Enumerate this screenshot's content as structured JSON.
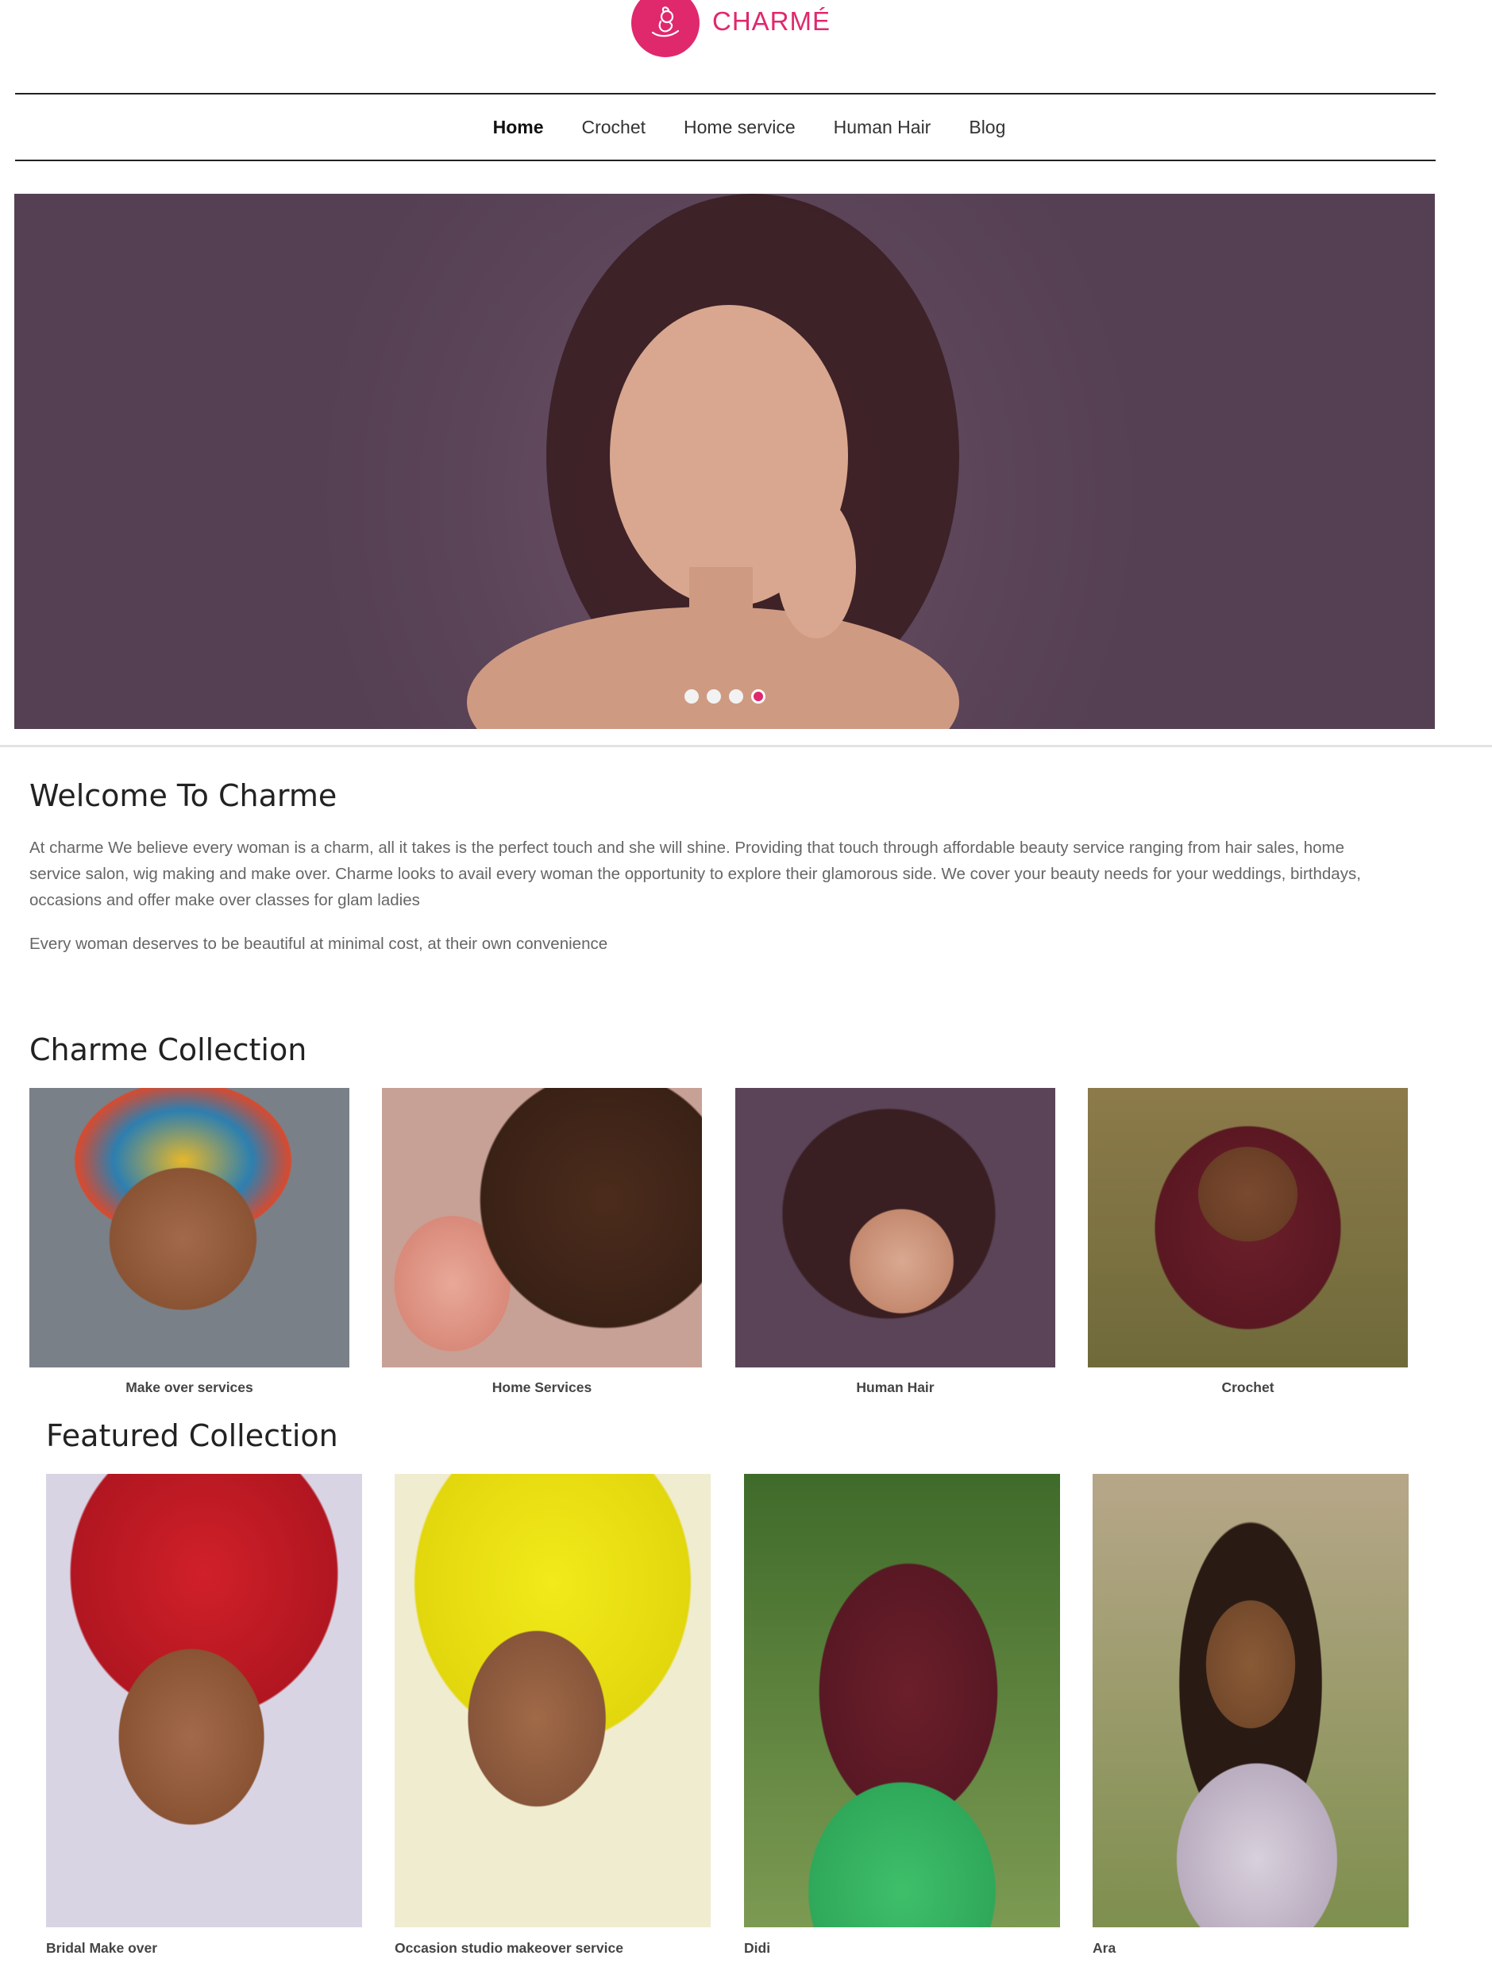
{
  "brand": {
    "name": "CHARMÉ",
    "logo_icon": "woman-flower-logo",
    "accent_color": "#e0286d"
  },
  "nav": {
    "items": [
      {
        "label": "Home",
        "active": true
      },
      {
        "label": "Crochet",
        "active": false
      },
      {
        "label": "Home service",
        "active": false
      },
      {
        "label": "Human Hair",
        "active": false
      },
      {
        "label": "Blog",
        "active": false
      }
    ]
  },
  "hero": {
    "slides_total": 4,
    "active_slide": 4
  },
  "welcome": {
    "title": "Welcome To Charme",
    "paragraph1": "At charme We believe every woman is a charm, all it takes is the perfect touch and she will shine. Providing that touch through affordable beauty service ranging from hair sales, home service salon, wig making and make over. Charme looks to avail every woman the opportunity to explore their glamorous side. We cover your beauty needs for your weddings, birthdays, occasions and offer make over classes for glam ladies",
    "paragraph2": "Every woman deserves to be beautiful at minimal cost, at their own convenience"
  },
  "collection": {
    "title": "Charme Collection",
    "items": [
      {
        "label": "Make over services"
      },
      {
        "label": "Home Services"
      },
      {
        "label": "Human Hair"
      },
      {
        "label": "Crochet"
      }
    ]
  },
  "featured": {
    "title": "Featured Collection",
    "items": [
      {
        "label": "Bridal Make over"
      },
      {
        "label": "Occasion studio makeover service"
      },
      {
        "label": "Didi"
      },
      {
        "label": "Ara"
      }
    ]
  }
}
